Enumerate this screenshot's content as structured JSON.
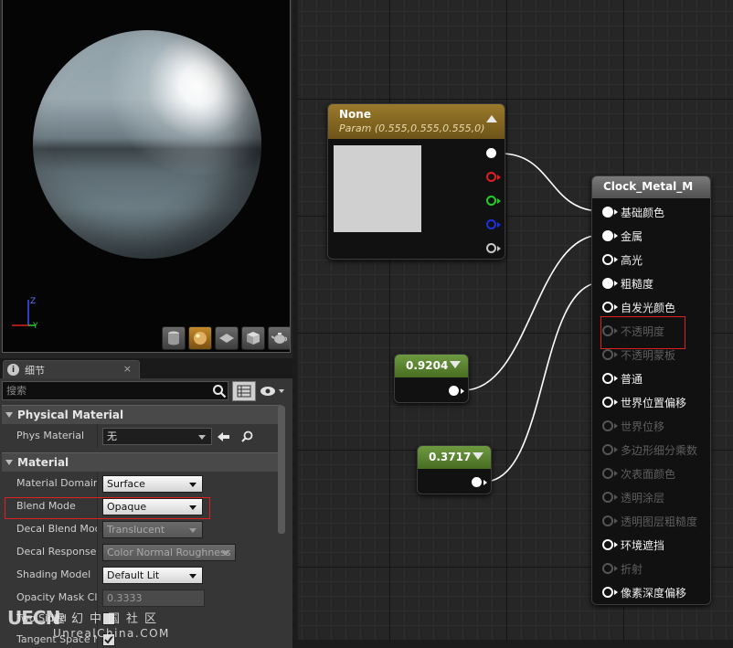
{
  "details_panel": {
    "tab_label": "细节",
    "tab_close": "×",
    "search_placeholder": "搜索",
    "categories": {
      "physical_material": "Physical Material",
      "material": "Material"
    },
    "properties": {
      "phys_material": {
        "label": "Phys Material",
        "value": "无"
      },
      "material_domain": {
        "label": "Material Domain",
        "value": "Surface"
      },
      "blend_mode": {
        "label": "Blend Mode",
        "value": "Opaque"
      },
      "decal_blend_mode": {
        "label": "Decal Blend Mode",
        "value": "Translucent"
      },
      "decal_response": {
        "label": "Decal Response (",
        "value": "Color Normal Roughness"
      },
      "shading_model": {
        "label": "Shading Model",
        "value": "Default Lit"
      },
      "opacity_mask_clip": {
        "label": "Opacity Mask Cli",
        "value": "0.3333"
      },
      "two_sided": {
        "label": "Two Sided"
      },
      "tangent_space": {
        "label": "Tangent Space N"
      }
    }
  },
  "viewport": {
    "axis_labels": {
      "z": "Z",
      "y": "Y"
    }
  },
  "graph": {
    "param_node": {
      "title": "None",
      "subtitle": "Param (0.555,0.555,0.555,0)",
      "swatch_color": "#d0d0d0"
    },
    "const_node_1": {
      "value": "0.9204"
    },
    "const_node_2": {
      "value": "0.3717"
    },
    "material_node": {
      "title": "Clock_Metal_M",
      "inputs": [
        {
          "label": "基础颜色",
          "connected": true,
          "enabled": true
        },
        {
          "label": "金属",
          "connected": true,
          "enabled": true
        },
        {
          "label": "高光",
          "connected": false,
          "enabled": true
        },
        {
          "label": "粗糙度",
          "connected": true,
          "enabled": true
        },
        {
          "label": "自发光颜色",
          "connected": false,
          "enabled": true
        },
        {
          "label": "不透明度",
          "connected": false,
          "enabled": false
        },
        {
          "label": "不透明蒙板",
          "connected": false,
          "enabled": false
        },
        {
          "label": "普通",
          "connected": false,
          "enabled": true
        },
        {
          "label": "世界位置偏移",
          "connected": false,
          "enabled": true
        },
        {
          "label": "世界位移",
          "connected": false,
          "enabled": false
        },
        {
          "label": "多边形细分乘数",
          "connected": false,
          "enabled": false
        },
        {
          "label": "次表面颜色",
          "connected": false,
          "enabled": false
        },
        {
          "label": "透明涂层",
          "connected": false,
          "enabled": false
        },
        {
          "label": "透明图层粗糙度",
          "connected": false,
          "enabled": false
        },
        {
          "label": "环境遮挡",
          "connected": false,
          "enabled": true
        },
        {
          "label": "折射",
          "connected": false,
          "enabled": false
        },
        {
          "label": "像素深度偏移",
          "connected": false,
          "enabled": true
        }
      ]
    }
  },
  "watermark": {
    "logo": "UECN",
    "cn": "虚幻中国社区",
    "en": "UnrealChina.COM"
  },
  "colors": {
    "highlight_box": "#e02020",
    "param_header": "#9a7a2c",
    "const_header": "#6e9a40"
  }
}
